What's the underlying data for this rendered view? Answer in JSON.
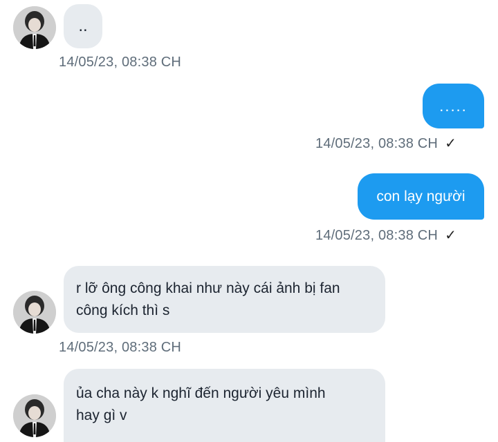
{
  "messages": [
    {
      "direction": "received",
      "text": "..",
      "time": "14/05/23,  08:38 CH"
    },
    {
      "direction": "sent",
      "text": ".....",
      "time": "14/05/23,  08:38 CH",
      "status_icon": "checkmark-icon"
    },
    {
      "direction": "sent",
      "text": "con lạy người",
      "time": "14/05/23,  08:38 CH",
      "status_icon": "checkmark-icon"
    },
    {
      "direction": "received",
      "lines": [
        "r lỡ ông công khai như này cái ảnh bị fan",
        "công kích thì s"
      ],
      "time": "14/05/23,  08:38 CH"
    },
    {
      "direction": "received",
      "lines": [
        "ủa cha này k nghĩ đến người yêu mình",
        "hay gì v"
      ]
    }
  ],
  "status_check_glyph": "✓",
  "colors": {
    "sent_bubble": "#1d9bf0",
    "received_bubble": "#e7ebef",
    "timestamp": "#5f6d7a"
  }
}
